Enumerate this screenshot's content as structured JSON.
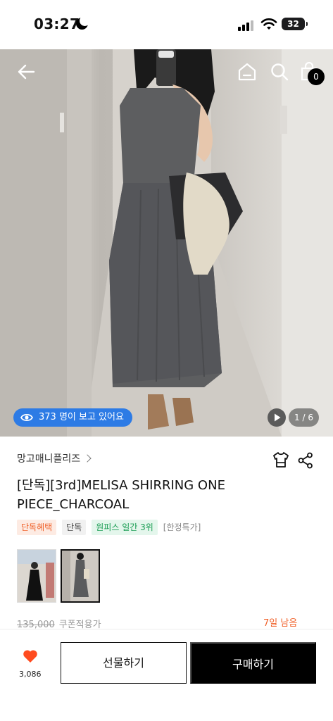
{
  "status_bar": {
    "time": "03:27",
    "battery": "32"
  },
  "hero": {
    "cart_count": "0",
    "viewer_text": "373 명이 보고 있어요",
    "page_indicator": "1 / 6"
  },
  "product": {
    "brand": "망고매니플리즈",
    "title": "[단독][3rd]MELISA SHIRRING ONE PIECE_CHARCOAL",
    "tags": [
      "단독혜택",
      "단독",
      "원피스 일간 3위",
      "[한정특가]"
    ],
    "original_price": "135,000",
    "price_label": "쿠폰적용가",
    "days_left": "7일 남음"
  },
  "bottom_bar": {
    "like_count": "3,086",
    "gift_label": "선물하기",
    "buy_label": "구매하기"
  },
  "colors": {
    "accent_orange": "#f0622b",
    "accent_green": "#1a9d53",
    "badge_blue": "#2d7be5",
    "heart_red": "#ff4b1f"
  }
}
